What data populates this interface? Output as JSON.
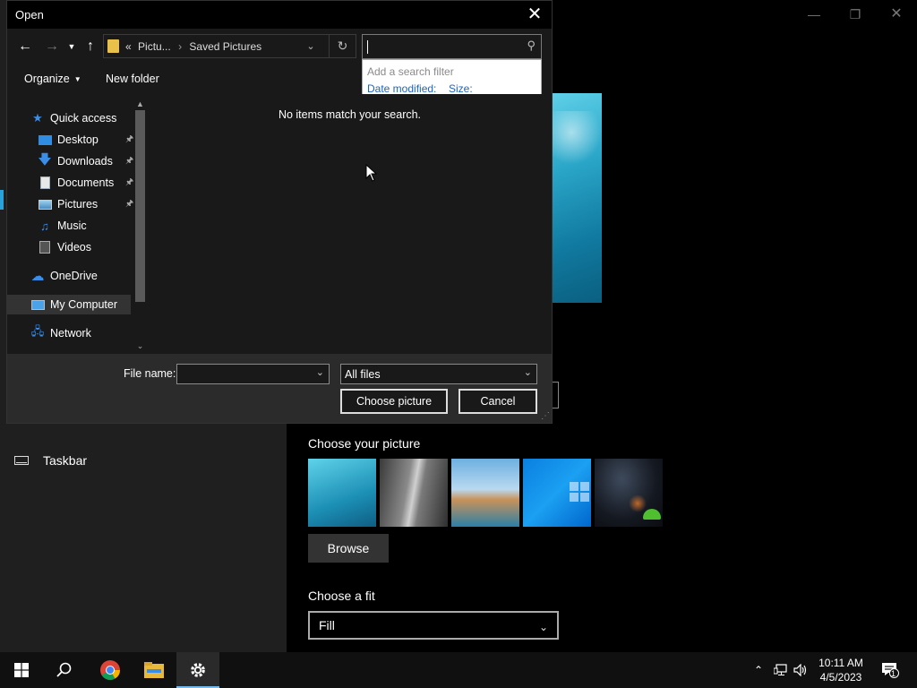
{
  "dialog": {
    "title": "Open",
    "address": {
      "parent": "Pictu...",
      "current": "Saved Pictures",
      "overflow": "«"
    },
    "search": {
      "value": "",
      "hint": "Add a search filter",
      "filters": [
        "Date modified:",
        "Size:"
      ]
    },
    "toolbar": {
      "organize": "Organize",
      "new_folder": "New folder"
    },
    "nav": {
      "quick_access": "Quick access",
      "items": [
        {
          "label": "Desktop",
          "icon": "desktop-icon",
          "pinned": true
        },
        {
          "label": "Downloads",
          "icon": "downloads-icon",
          "pinned": true
        },
        {
          "label": "Documents",
          "icon": "documents-icon",
          "pinned": true
        },
        {
          "label": "Pictures",
          "icon": "pictures-icon",
          "pinned": true
        },
        {
          "label": "Music",
          "icon": "music-icon",
          "pinned": false
        },
        {
          "label": "Videos",
          "icon": "videos-icon",
          "pinned": false
        }
      ],
      "onedrive": "OneDrive",
      "my_computer": "My Computer",
      "network": "Network"
    },
    "empty_message": "No items match your search.",
    "file_name_label": "File name:",
    "file_name_value": "",
    "file_type": "All files",
    "choose_button": "Choose picture",
    "cancel_button": "Cancel"
  },
  "settings": {
    "taskbar_item": "Taskbar",
    "choose_picture_title": "Choose your picture",
    "browse_button": "Browse",
    "choose_fit_title": "Choose a fit",
    "fit_value": "Fill"
  },
  "taskbar": {
    "time": "10:11 AM",
    "date": "4/5/2023",
    "notification_count": "1"
  },
  "colors": {
    "accent": "#2aa1d9",
    "link_blue": "#1a64c8"
  }
}
